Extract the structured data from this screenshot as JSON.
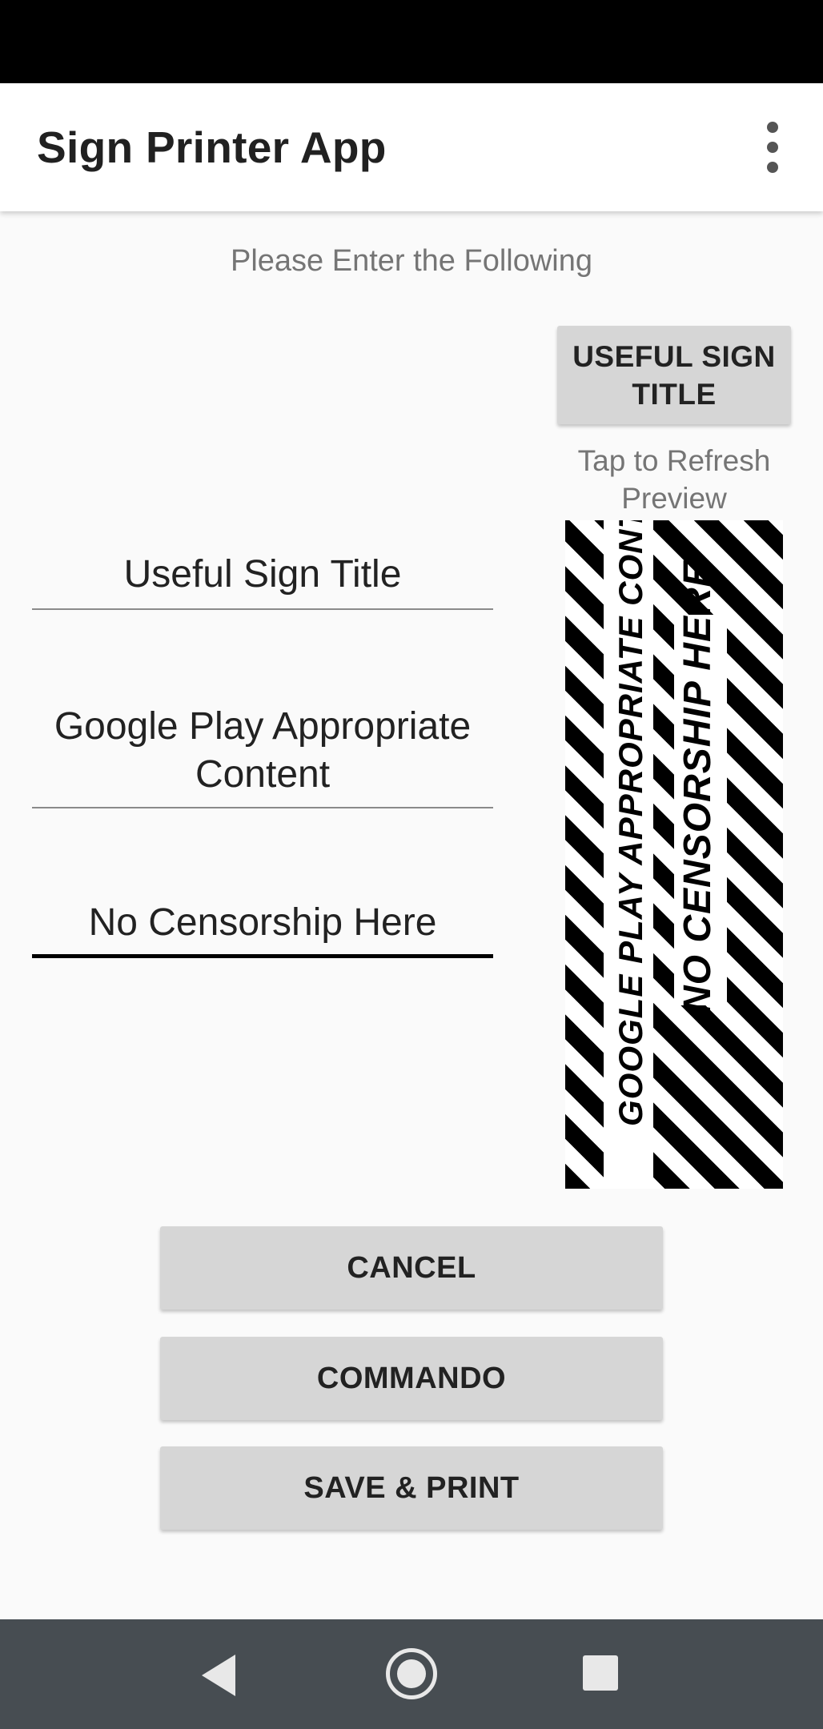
{
  "app_bar": {
    "title": "Sign Printer App",
    "menu_icon": "overflow-menu-icon"
  },
  "form": {
    "instructions": "Please Enter the Following",
    "title_field": {
      "value": "Useful Sign Title"
    },
    "content_field": {
      "value_line1": "Google Play Appropriate",
      "value_line2": "Content"
    },
    "footer_field": {
      "value": "No Censorship Here"
    }
  },
  "preview": {
    "button_label_line1": "USEFUL SIGN",
    "button_label_line2": "TITLE",
    "hint_line1": "Tap to Refresh",
    "hint_line2": "Preview",
    "sign_line1": "GOOGLE PLAY APPROPRIATE CONTENT",
    "sign_line2": "NO CENSORSHIP HERE"
  },
  "actions": {
    "cancel_label": "CANCEL",
    "commando_label": "COMMANDO",
    "save_print_label": "SAVE & PRINT"
  },
  "nav_bar": {
    "back_icon": "back-triangle-icon",
    "home_icon": "home-circle-icon",
    "recents_icon": "recents-square-icon"
  },
  "colors": {
    "app_bar": "#ffffff",
    "background": "#fafafa",
    "button": "#d6d6d6",
    "nav_bar": "#474d52",
    "status_bar": "#000000"
  }
}
